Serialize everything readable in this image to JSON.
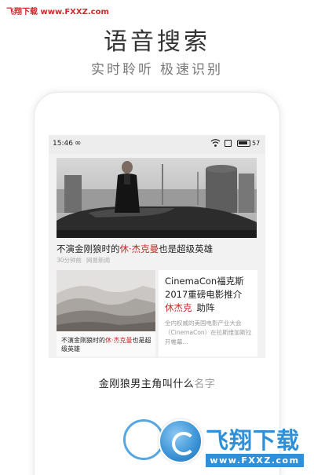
{
  "watermark": {
    "top_text": "飞翔下载 www.FXXZ.com",
    "logo_name": "飞翔下载",
    "logo_url": "www.FXXZ.com",
    "accent": "#d8262c",
    "logo_color": "#2f8fd8"
  },
  "hero": {
    "title": "语音搜索",
    "subtitle_part1": "实时聆听",
    "subtitle_part2": "极速识别"
  },
  "phone": {
    "status_bar": {
      "time": "15:46",
      "loop_glyph": "∞",
      "battery_level": "57",
      "icons": [
        "wifi-icon",
        "sim-icon",
        "battery-icon"
      ]
    },
    "feed": {
      "story1": {
        "title_pre": "不演金刚狼时的",
        "title_highlight": "休·杰克曼",
        "title_post": "也是超级英雄",
        "time": "30分钟前",
        "source": "网易新闻"
      },
      "story2": {
        "title_pre": "不演金刚狼时的",
        "title_highlight": "休·杰克曼",
        "title_post": "也是超级英雄"
      },
      "story3": {
        "title_line1": "CinemaCon福克斯",
        "title_line2": "2017重磅电影推介",
        "title_highlight": "休杰克",
        "title_post": "助阵",
        "description": "全内权威的美国电影产业大会（CinemaCon）在拉斯维加斯拉开帷幕..."
      },
      "highlight_color": "#c62828"
    },
    "voice": {
      "query_main": "金刚狼男主角叫什么",
      "query_tail": "名字",
      "mic_color": "#56a6e4"
    }
  }
}
